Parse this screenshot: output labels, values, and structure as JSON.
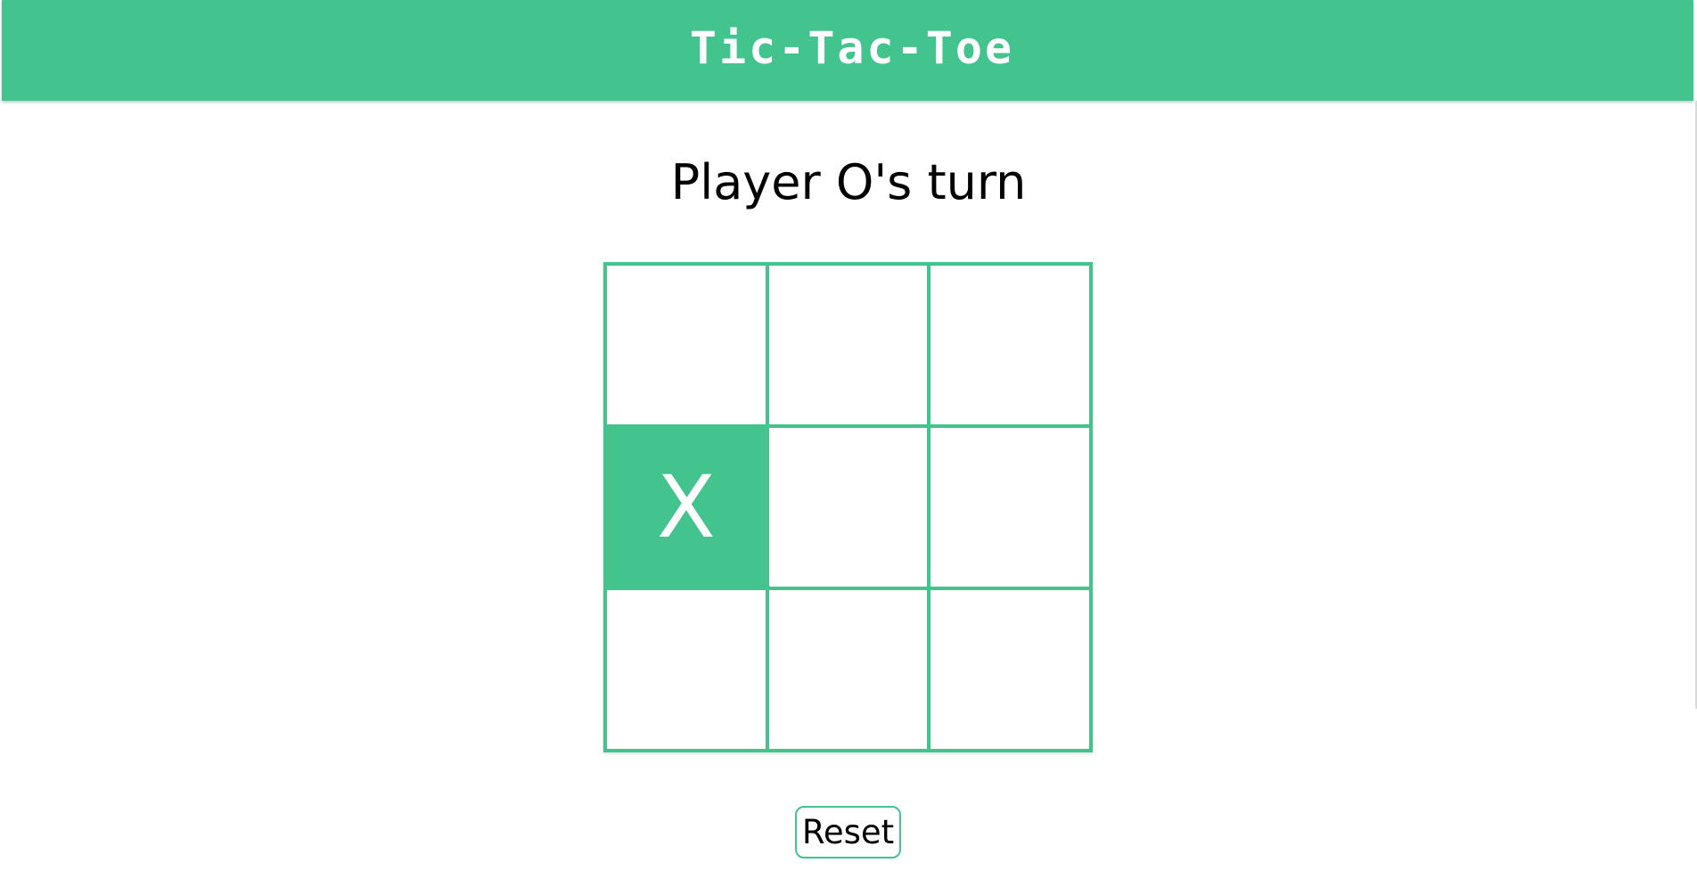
{
  "header": {
    "title": "Tic-Tac-Toe"
  },
  "status": {
    "text": "Player O's turn"
  },
  "board": {
    "cells": [
      "",
      "",
      "",
      "X",
      "",
      "",
      "",
      "",
      ""
    ]
  },
  "controls": {
    "reset_label": "Reset"
  },
  "colors": {
    "accent": "#43c48f",
    "background": "#ffffff",
    "mark": "#ffffff"
  }
}
